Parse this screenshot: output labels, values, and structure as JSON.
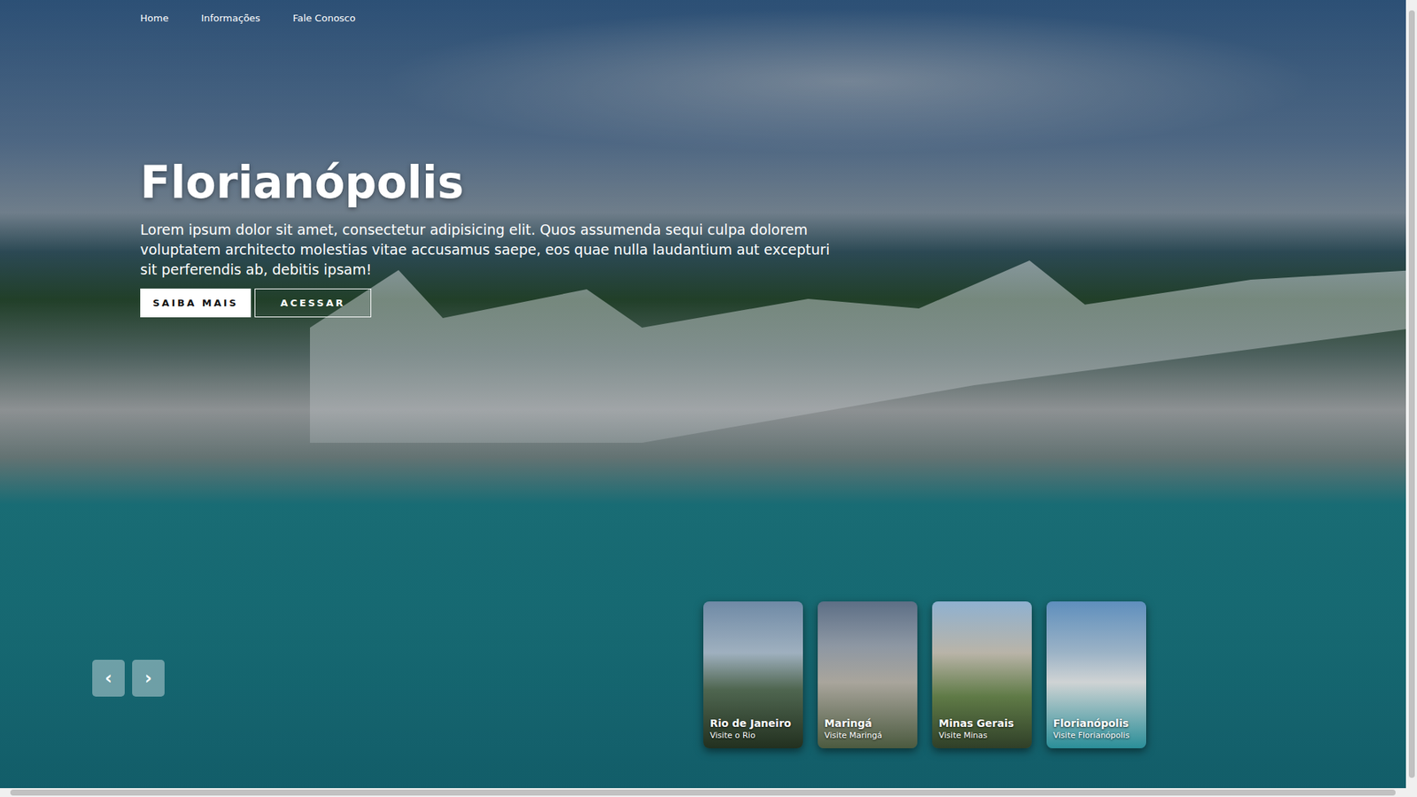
{
  "nav": [
    {
      "label": "Home"
    },
    {
      "label": "Informações"
    },
    {
      "label": "Fale Conosco"
    }
  ],
  "hero": {
    "title": "Florianópolis",
    "description": "Lorem ipsum dolor sit amet, consectetur adipisicing elit. Quos assumenda sequi culpa dolorem voluptatem architecto molestias vitae accusamus saepe, eos quae nulla laudantium aut excepturi sit perferendis ab, debitis ipsam!"
  },
  "buttons": [
    {
      "label": "SAIBA MAIS",
      "kind": "filled"
    },
    {
      "label": "ACESSAR",
      "kind": "outline"
    }
  ],
  "arrows": [
    {
      "label": "‹"
    },
    {
      "label": "›"
    }
  ],
  "cards": [
    {
      "title": "Rio de Janeiro",
      "subtitle": "Visite o Rio"
    },
    {
      "title": "Maringá",
      "subtitle": "Visite Maringá"
    },
    {
      "title": "Minas Gerais",
      "subtitle": "Visite Minas"
    },
    {
      "title": "Florianópolis",
      "subtitle": "Visite Florianópolis"
    }
  ]
}
